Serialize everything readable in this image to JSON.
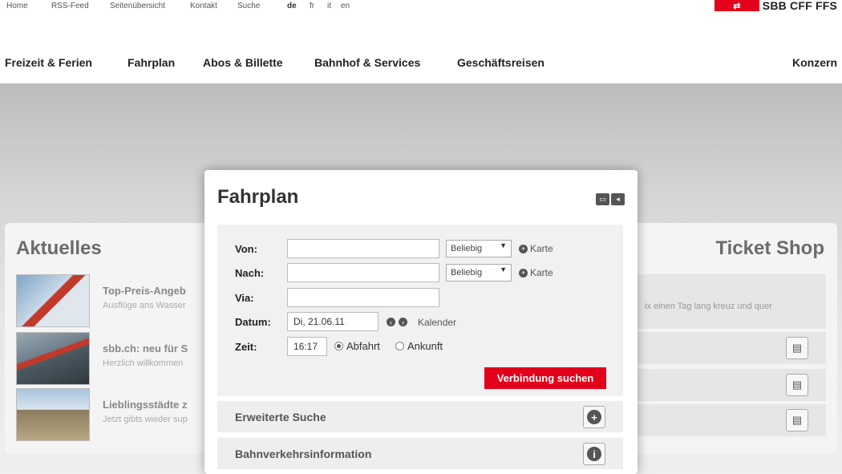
{
  "meta_nav": [
    "Home",
    "RSS-Feed",
    "Seitenübersicht",
    "Kontakt",
    "Suche"
  ],
  "languages": [
    "de",
    "fr",
    "it",
    "en"
  ],
  "logo": {
    "text": "SBB CFF FFS",
    "color": "#e2001a"
  },
  "main_nav": [
    "Freizeit & Ferien",
    "Fahrplan",
    "Abos & Billette",
    "Bahnhof & Services",
    "Geschäftsreisen"
  ],
  "main_nav_right": "Konzern",
  "aktuelles": {
    "title": "Aktuelles",
    "items": [
      {
        "title": "Top-Preis-Angeb",
        "sub": "Ausflüge ans Wasser"
      },
      {
        "title": "sbb.ch: neu für S",
        "sub": "Herzlich willkommen"
      },
      {
        "title": "Lieblingsstädte z",
        "sub": "Jetzt gibts wieder sup"
      }
    ]
  },
  "ticket_shop": {
    "title": "Ticket Shop",
    "first_text": "ix einen Tag lang kreuz und quer"
  },
  "fahrplan": {
    "title": "Fahrplan",
    "von_label": "Von:",
    "nach_label": "Nach:",
    "via_label": "Via:",
    "datum_label": "Datum:",
    "zeit_label": "Zeit:",
    "select_value": "Beliebig",
    "karte": "Karte",
    "datum_value": "Di, 21.06.11",
    "kalender": "Kalender",
    "zeit_value": "16:17",
    "abfahrt": "Abfahrt",
    "ankunft": "Ankunft",
    "submit": "Verbindung suchen",
    "erweiterte": "Erweiterte Suche",
    "bahnverkehr": "Bahnverkehrsinformation"
  }
}
